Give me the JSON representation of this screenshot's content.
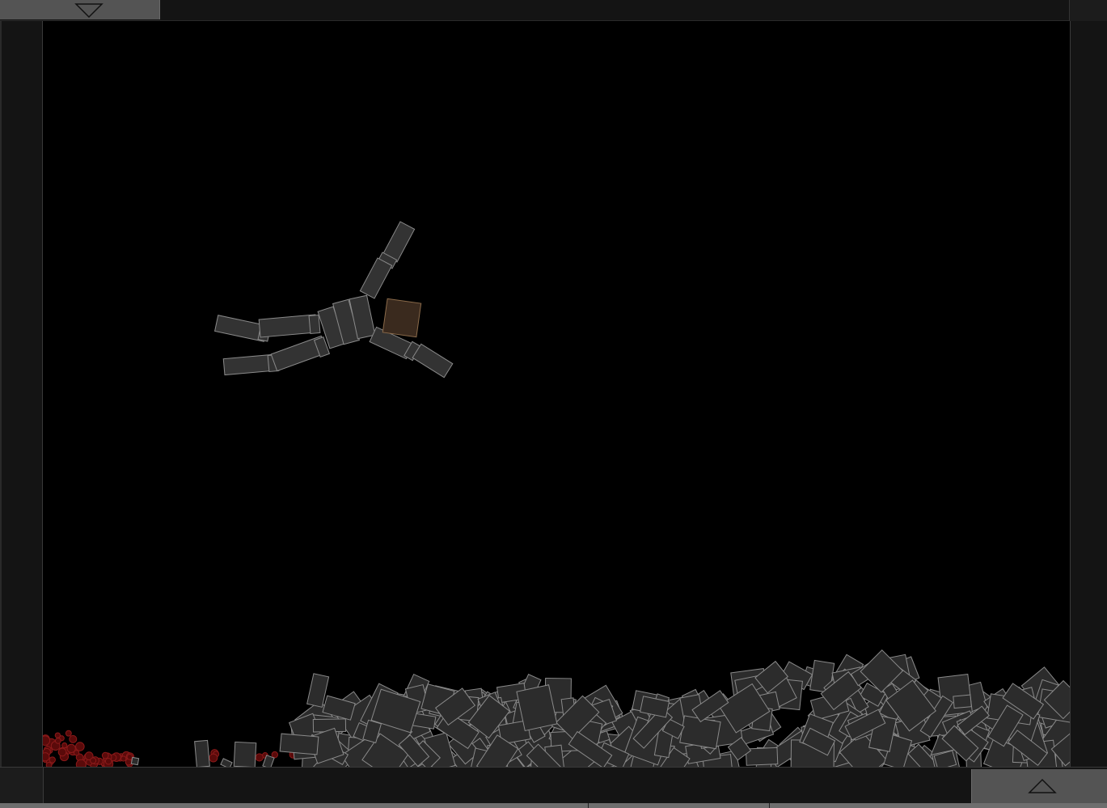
{
  "colors": {
    "background": "#000000",
    "frame": "#141414",
    "tab": "#545454",
    "block_fill": "#2c2c2c",
    "block_stroke": "#8a8a8a",
    "ragdoll_fill": "#333333",
    "head_fill": "#3a2a1e",
    "head_stroke": "#8a6a4a",
    "blood": "#5a0a0a",
    "blood_stroke": "#8b1a1a"
  },
  "icons": {
    "top_tab": "triangle-down-icon",
    "bottom_tab": "triangle-up-icon"
  }
}
